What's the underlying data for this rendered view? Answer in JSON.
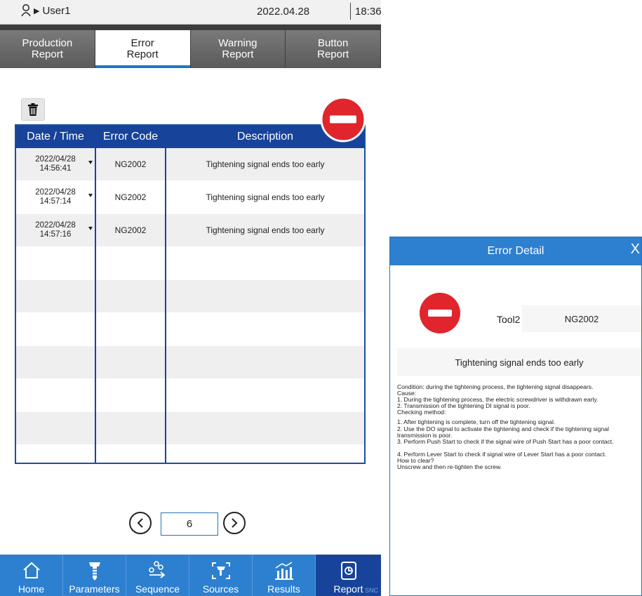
{
  "status": {
    "user": "User1",
    "date": "2022.04.28",
    "time": "18:36"
  },
  "tabs": [
    {
      "label": "Production\nReport",
      "active": false
    },
    {
      "label": "Error\nReport",
      "active": true
    },
    {
      "label": "Warning\nReport",
      "active": false
    },
    {
      "label": "Button\nReport",
      "active": false
    }
  ],
  "table": {
    "headers": {
      "datetime": "Date / Time",
      "code": "Error Code",
      "desc": "Description"
    },
    "rows": [
      {
        "date": "2022/04/28",
        "time": "14:56:41",
        "code": "NG2002",
        "desc": "Tightening signal ends too early"
      },
      {
        "date": "2022/04/28",
        "time": "14:57:14",
        "code": "NG2002",
        "desc": "Tightening signal ends too early"
      },
      {
        "date": "2022/04/28",
        "time": "14:57:16",
        "code": "NG2002",
        "desc": "Tightening signal ends too early"
      }
    ]
  },
  "pager": {
    "page": "6"
  },
  "nav": [
    {
      "label": "Home",
      "icon": "home-icon"
    },
    {
      "label": "Parameters",
      "icon": "screw-icon"
    },
    {
      "label": "Sequence",
      "icon": "sequence-icon"
    },
    {
      "label": "Sources",
      "icon": "sources-icon"
    },
    {
      "label": "Results",
      "icon": "results-icon"
    },
    {
      "label": "Report",
      "icon": "report-icon",
      "active": true
    }
  ],
  "watermark": "SNC",
  "dialog": {
    "title": "Error Detail",
    "close": "X",
    "tool": "Tool2",
    "code": "NG2002",
    "description": "Tightening signal ends too early",
    "lines": [
      "Condition: during the tightening process, the tightening signal disappears.",
      "Cause:",
      "1. During the tightening process, the electric screwdriver is withdrawn early.",
      "2. Transmission of the tightening DI signal is poor.",
      "Checking method:",
      "",
      "1. After tightening is complete, turn off the tightening signal.",
      "2. Use the DO signal to activate the tightening and check if the tightening signal transmission is poor.",
      "3. Perform Push Start to check if the signal wire of Push Start has a poor contact.",
      "",
      "4. Perform Lever Start to check if signal wire of Lever Start has a poor contact.",
      "How to clear?",
      "Unscrew and then re-tighten the screw."
    ]
  },
  "colors": {
    "accent": "#2d7fd0",
    "header": "#17449a",
    "stop": "#e0252c"
  }
}
